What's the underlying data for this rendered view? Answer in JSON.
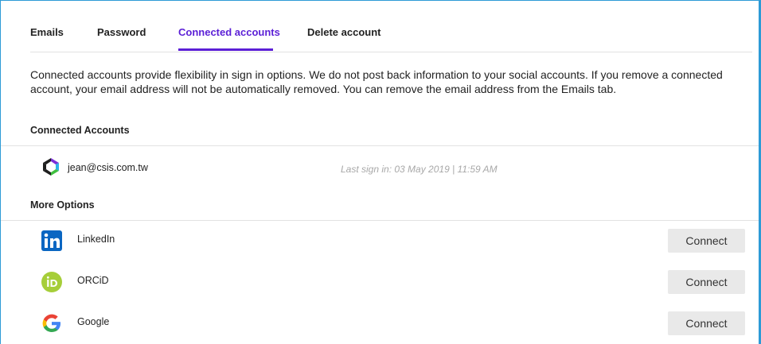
{
  "tabs": [
    {
      "label": "Emails"
    },
    {
      "label": "Password"
    },
    {
      "label": "Connected accounts"
    },
    {
      "label": "Delete account"
    }
  ],
  "active_tab": "Connected accounts",
  "description": "Connected accounts provide flexibility in sign in options. We do not post back information to your social accounts. If you remove a connected account, your email address will not be automatically removed. You can remove the email address from the Emails tab.",
  "connected_section": {
    "title": "Connected Accounts",
    "account": {
      "email": "jean@csis.com.tw",
      "last_sign_in": "Last sign in: 03 May 2019 | 11:59 AM",
      "icon": "clarivate-logo-icon"
    }
  },
  "more_section": {
    "title": "More Options",
    "options": [
      {
        "name": "LinkedIn",
        "icon": "linkedin-icon",
        "button": "Connect"
      },
      {
        "name": "ORCiD",
        "icon": "orcid-icon",
        "button": "Connect"
      },
      {
        "name": "Google",
        "icon": "google-icon",
        "button": "Connect"
      }
    ]
  },
  "colors": {
    "accent": "#5b1fd6",
    "frame": "#2d9bd6",
    "linkedin": "#0a66c2",
    "orcid": "#a6ce39"
  }
}
